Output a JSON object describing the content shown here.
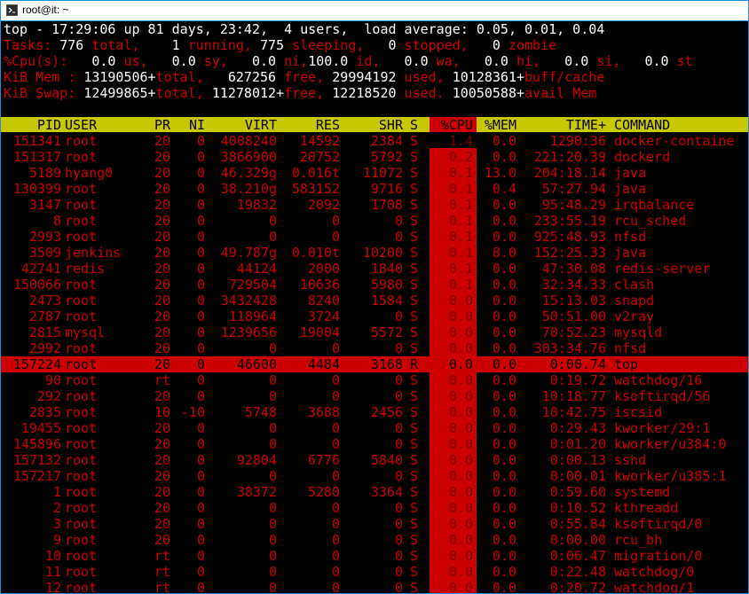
{
  "window": {
    "title": "root@it: ~",
    "icon": "terminal-icon"
  },
  "summary": {
    "line1": "top - 17:29:06 up 81 days, 23:42,  4 users,  load average: 0.05, 0.01, 0.04",
    "tasks": [
      {
        "t": "Tasks: ",
        "c": "red"
      },
      {
        "t": "776",
        "c": "white"
      },
      {
        "t": " total,    ",
        "c": "red"
      },
      {
        "t": "1",
        "c": "white"
      },
      {
        "t": " running, ",
        "c": "red"
      },
      {
        "t": "775",
        "c": "white"
      },
      {
        "t": " sleeping,   ",
        "c": "red"
      },
      {
        "t": "0",
        "c": "white"
      },
      {
        "t": " stopped,   ",
        "c": "red"
      },
      {
        "t": "0",
        "c": "white"
      },
      {
        "t": " zombie",
        "c": "red"
      }
    ],
    "cpu": [
      {
        "t": "%Cpu(s): ",
        "c": "red"
      },
      {
        "t": "  0.0",
        "c": "white"
      },
      {
        "t": " us, ",
        "c": "red"
      },
      {
        "t": "  0.0",
        "c": "white"
      },
      {
        "t": " sy, ",
        "c": "red"
      },
      {
        "t": "  0.0",
        "c": "white"
      },
      {
        "t": " ni,",
        "c": "red"
      },
      {
        "t": "100.0",
        "c": "white"
      },
      {
        "t": " id, ",
        "c": "red"
      },
      {
        "t": "  0.0",
        "c": "white"
      },
      {
        "t": " wa, ",
        "c": "red"
      },
      {
        "t": "  0.0",
        "c": "white"
      },
      {
        "t": " hi, ",
        "c": "red"
      },
      {
        "t": "  0.0",
        "c": "white"
      },
      {
        "t": " si, ",
        "c": "red"
      },
      {
        "t": "  0.0",
        "c": "white"
      },
      {
        "t": " st",
        "c": "red"
      }
    ],
    "mem": [
      {
        "t": "KiB Mem : ",
        "c": "red"
      },
      {
        "t": "13190506+",
        "c": "white"
      },
      {
        "t": "total, ",
        "c": "red"
      },
      {
        "t": "  627256",
        "c": "white"
      },
      {
        "t": " free, ",
        "c": "red"
      },
      {
        "t": "29994192",
        "c": "white"
      },
      {
        "t": " used, ",
        "c": "red"
      },
      {
        "t": "10128361+",
        "c": "white"
      },
      {
        "t": "buff/cache",
        "c": "red"
      }
    ],
    "swap": [
      {
        "t": "KiB Swap: ",
        "c": "red"
      },
      {
        "t": "12499865+",
        "c": "white"
      },
      {
        "t": "total, ",
        "c": "red"
      },
      {
        "t": "11278012+",
        "c": "white"
      },
      {
        "t": "free, ",
        "c": "red"
      },
      {
        "t": "12218520",
        "c": "white"
      },
      {
        "t": " used. ",
        "c": "red"
      },
      {
        "t": "10050588+",
        "c": "white"
      },
      {
        "t": "avail Mem",
        "c": "red"
      }
    ]
  },
  "columns": [
    "PID",
    "USER",
    "PR",
    "NI",
    "VIRT",
    "RES",
    "SHR",
    "S",
    "%CPU",
    "%MEM",
    "TIME+",
    "COMMAND"
  ],
  "processes": [
    [
      "151341",
      "root",
      "20",
      "0",
      "4008240",
      "14592",
      "2384",
      "S",
      "1.4",
      "0.0",
      "1290:36",
      "docker-containe"
    ],
    [
      "151317",
      "root",
      "20",
      "0",
      "3866900",
      "20752",
      "5792",
      "S",
      "0.2",
      "0.0",
      "221:20.39",
      "dockerd"
    ],
    [
      "5189",
      "hyang0",
      "20",
      "0",
      "46.329g",
      "0.016t",
      "11072",
      "S",
      "0.1",
      "13.0",
      "204:18.14",
      "java"
    ],
    [
      "130399",
      "root",
      "20",
      "0",
      "38.210g",
      "583152",
      "9716",
      "S",
      "0.1",
      "0.4",
      "57:27.94",
      "java"
    ],
    [
      "3147",
      "root",
      "20",
      "0",
      "19832",
      "2092",
      "1708",
      "S",
      "0.1",
      "0.0",
      "95:48.29",
      "irqbalance"
    ],
    [
      "8",
      "root",
      "20",
      "0",
      "0",
      "0",
      "0",
      "S",
      "0.1",
      "0.0",
      "233:55.19",
      "rcu_sched"
    ],
    [
      "2993",
      "root",
      "20",
      "0",
      "0",
      "0",
      "0",
      "S",
      "0.1",
      "0.0",
      "925:48.93",
      "nfsd"
    ],
    [
      "3509",
      "jenkins",
      "20",
      "0",
      "49.787g",
      "0.010t",
      "10200",
      "S",
      "0.1",
      "8.0",
      "152:25.33",
      "java"
    ],
    [
      "42741",
      "redis",
      "20",
      "0",
      "44124",
      "2000",
      "1840",
      "S",
      "0.1",
      "0.0",
      "47:30.08",
      "redis-server"
    ],
    [
      "150066",
      "root",
      "20",
      "0",
      "729504",
      "10636",
      "5980",
      "S",
      "0.1",
      "0.0",
      "32:34.33",
      "clash"
    ],
    [
      "2473",
      "root",
      "20",
      "0",
      "3432428",
      "8240",
      "1584",
      "S",
      "0.0",
      "0.0",
      "15:13.03",
      "snapd"
    ],
    [
      "2787",
      "root",
      "20",
      "0",
      "118964",
      "3724",
      "0",
      "S",
      "0.0",
      "0.0",
      "50:51.00",
      "v2ray"
    ],
    [
      "2815",
      "mysql",
      "20",
      "0",
      "1239656",
      "19004",
      "5572",
      "S",
      "0.0",
      "0.0",
      "70:52.23",
      "mysqld"
    ],
    [
      "2992",
      "root",
      "20",
      "0",
      "0",
      "0",
      "0",
      "S",
      "0.0",
      "0.0",
      "303:34.76",
      "nfsd"
    ],
    [
      "157224",
      "root",
      "20",
      "0",
      "46600",
      "4484",
      "3168",
      "R",
      "0.0",
      "0.0",
      "0:00.74",
      "top"
    ],
    [
      "90",
      "root",
      "rt",
      "0",
      "0",
      "0",
      "0",
      "S",
      "0.0",
      "0.0",
      "0:19.72",
      "watchdog/16"
    ],
    [
      "292",
      "root",
      "20",
      "0",
      "0",
      "0",
      "0",
      "S",
      "0.0",
      "0.0",
      "10:18.77",
      "ksoftirqd/56"
    ],
    [
      "2835",
      "root",
      "10",
      "-10",
      "5748",
      "3688",
      "2456",
      "S",
      "0.0",
      "0.0",
      "10:42.75",
      "iscsid"
    ],
    [
      "19455",
      "root",
      "20",
      "0",
      "0",
      "0",
      "0",
      "S",
      "0.0",
      "0.0",
      "0:29.43",
      "kworker/29:1"
    ],
    [
      "145896",
      "root",
      "20",
      "0",
      "0",
      "0",
      "0",
      "S",
      "0.0",
      "0.0",
      "0:01.20",
      "kworker/u384:0"
    ],
    [
      "157132",
      "root",
      "20",
      "0",
      "92804",
      "6776",
      "5840",
      "S",
      "0.0",
      "0.0",
      "0:00.13",
      "sshd"
    ],
    [
      "157217",
      "root",
      "20",
      "0",
      "0",
      "0",
      "0",
      "S",
      "0.0",
      "0.0",
      "0:00.01",
      "kworker/u385:1"
    ],
    [
      "1",
      "root",
      "20",
      "0",
      "38372",
      "5280",
      "3364",
      "S",
      "0.0",
      "0.0",
      "0:59.60",
      "systemd"
    ],
    [
      "2",
      "root",
      "20",
      "0",
      "0",
      "0",
      "0",
      "S",
      "0.0",
      "0.0",
      "0:10.52",
      "kthreadd"
    ],
    [
      "3",
      "root",
      "20",
      "0",
      "0",
      "0",
      "0",
      "S",
      "0.0",
      "0.0",
      "0:55.84",
      "ksoftirqd/0"
    ],
    [
      "9",
      "root",
      "20",
      "0",
      "0",
      "0",
      "0",
      "S",
      "0.0",
      "0.0",
      "0:00.00",
      "rcu_bh"
    ],
    [
      "10",
      "root",
      "rt",
      "0",
      "0",
      "0",
      "0",
      "S",
      "0.0",
      "0.0",
      "0:06.47",
      "migration/0"
    ],
    [
      "11",
      "root",
      "rt",
      "0",
      "0",
      "0",
      "0",
      "S",
      "0.0",
      "0.0",
      "0:22.48",
      "watchdog/0"
    ],
    [
      "12",
      "root",
      "rt",
      "0",
      "0",
      "0",
      "0",
      "S",
      "0.0",
      "0.0",
      "0:20.72",
      "watchdog/1"
    ]
  ],
  "highlighted_pid": "157224",
  "colors": {
    "accent": "#cc0000",
    "header_bar": "#c8c800",
    "background": "#000000",
    "window_border": "#1e8fe0"
  }
}
